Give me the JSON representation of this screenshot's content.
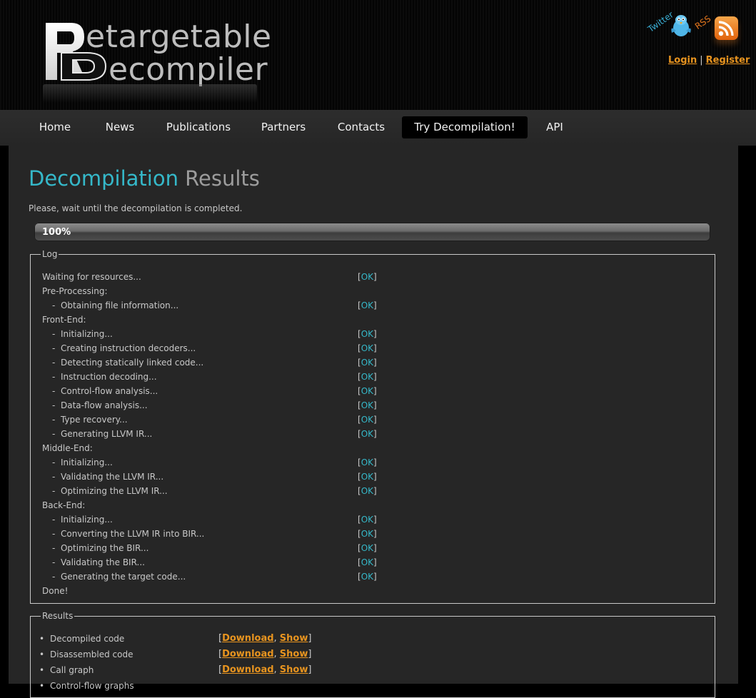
{
  "header": {
    "logo_word1": "etargetable",
    "logo_word2": "ecompiler",
    "twitter_label": "Twitter",
    "rss_label": "RSS",
    "login": "Login",
    "separator": "|",
    "register": "Register"
  },
  "nav": {
    "items": [
      "Home",
      "News",
      "Publications",
      "Partners",
      "Contacts",
      "Try Decompilation!",
      "API"
    ],
    "active": "Try Decompilation!"
  },
  "main": {
    "title_part1": "Decompilation",
    "title_part2": "Results",
    "wait_text": "Please, wait until the decompilation is completed.",
    "progress": {
      "label": "100%",
      "value": 1.0
    },
    "log": {
      "legend": "Log",
      "lines": [
        {
          "text": "Waiting for resources...",
          "sub": false,
          "status": "OK"
        },
        {
          "text": "Pre-Processing:",
          "sub": false,
          "status": ""
        },
        {
          "text": "Obtaining file information...",
          "sub": true,
          "status": "OK"
        },
        {
          "text": "Front-End:",
          "sub": false,
          "status": ""
        },
        {
          "text": "Initializing...",
          "sub": true,
          "status": "OK"
        },
        {
          "text": "Creating instruction decoders...",
          "sub": true,
          "status": "OK"
        },
        {
          "text": "Detecting statically linked code...",
          "sub": true,
          "status": "OK"
        },
        {
          "text": "Instruction decoding...",
          "sub": true,
          "status": "OK"
        },
        {
          "text": "Control-flow analysis...",
          "sub": true,
          "status": "OK"
        },
        {
          "text": "Data-flow analysis...",
          "sub": true,
          "status": "OK"
        },
        {
          "text": "Type recovery...",
          "sub": true,
          "status": "OK"
        },
        {
          "text": "Generating LLVM IR...",
          "sub": true,
          "status": "OK"
        },
        {
          "text": "Middle-End:",
          "sub": false,
          "status": ""
        },
        {
          "text": "Initializing...",
          "sub": true,
          "status": "OK"
        },
        {
          "text": "Validating the LLVM IR...",
          "sub": true,
          "status": "OK"
        },
        {
          "text": "Optimizing the LLVM IR...",
          "sub": true,
          "status": "OK"
        },
        {
          "text": "Back-End:",
          "sub": false,
          "status": ""
        },
        {
          "text": "Initializing...",
          "sub": true,
          "status": "OK"
        },
        {
          "text": "Converting the LLVM IR into BIR...",
          "sub": true,
          "status": "OK"
        },
        {
          "text": "Optimizing the BIR...",
          "sub": true,
          "status": "OK"
        },
        {
          "text": "Validating the BIR...",
          "sub": true,
          "status": "OK"
        },
        {
          "text": "Generating the target code...",
          "sub": true,
          "status": "OK"
        },
        {
          "text": "Done!",
          "sub": false,
          "status": ""
        }
      ]
    },
    "results": {
      "legend": "Results",
      "download_label": "Download",
      "show_label": "Show",
      "items": [
        {
          "name": "Decompiled code",
          "links": true
        },
        {
          "name": "Disassembled code",
          "links": true
        },
        {
          "name": "Call graph",
          "links": true
        },
        {
          "name": "Control-flow graphs",
          "links": false
        }
      ]
    }
  },
  "colors": {
    "accent_cyan": "#35b8c9",
    "link_orange": "#e8941f",
    "content_bg": "#262626",
    "nav_active_bg": "#000000"
  },
  "icons": [
    "twitter-bird-icon",
    "rss-feed-icon",
    "logo-rd-icon"
  ]
}
